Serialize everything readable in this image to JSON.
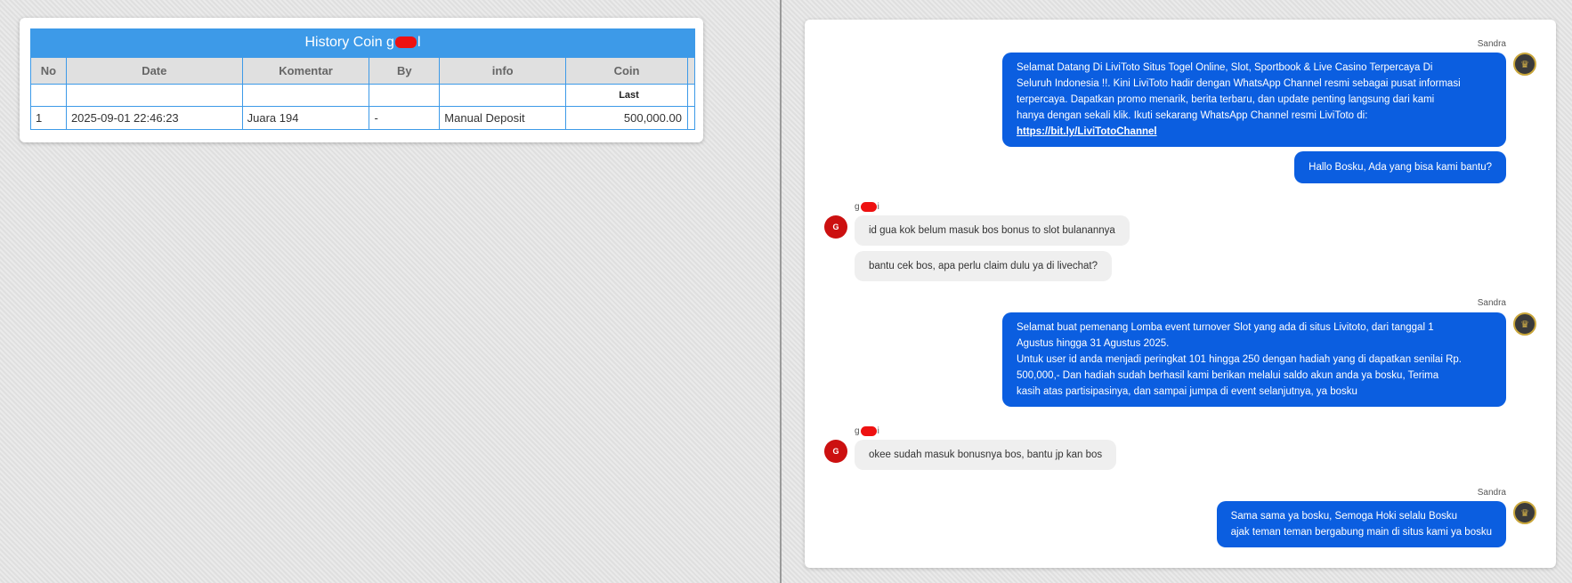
{
  "history": {
    "title_prefix": "History Coin g",
    "title_suffix": "l",
    "columns": [
      "No",
      "Date",
      "Komentar",
      "By",
      "info",
      "Coin"
    ],
    "sub_header": "Last",
    "rows": [
      {
        "no": "1",
        "date": "2025-09-01 22:46:23",
        "komentar": "Juara 194",
        "by": "-",
        "info": "Manual Deposit",
        "coin": "500,000.00"
      }
    ]
  },
  "chat": {
    "agent_name": "Sandra",
    "user_name_prefix": "g",
    "user_name_suffix": "i",
    "user_avatar_letter": "G",
    "messages": [
      {
        "from": "agent",
        "lines": [
          "Selamat Datang Di LiviToto Situs Togel Online, Slot, Sportbook & Live Casino Terpercaya Di",
          "Seluruh Indonesia !!. Kini LiviToto hadir dengan WhatsApp Channel resmi sebagai pusat informasi",
          "terpercaya. Dapatkan promo menarik, berita terbaru, dan update penting langsung dari kami",
          "hanya dengan sekali klik. Ikuti sekarang WhatsApp Channel resmi LiviToto di:"
        ],
        "link": "https://bit.ly/LiviTotoChannel"
      },
      {
        "from": "agent",
        "text": "Hallo Bosku, Ada yang bisa kami bantu?"
      },
      {
        "from": "user",
        "text": "id gua kok belum masuk bos bonus to slot bulanannya"
      },
      {
        "from": "user",
        "text": "bantu cek bos, apa perlu claim dulu ya di livechat?"
      },
      {
        "from": "agent",
        "lines": [
          "Selamat buat pemenang Lomba event turnover Slot yang ada di situs Livitoto, dari tanggal 1",
          "Agustus hingga 31 Agustus 2025.",
          "Untuk user id anda menjadi peringkat 101 hingga 250 dengan hadiah yang di dapatkan senilai Rp.",
          "500,000,- Dan hadiah sudah berhasil kami berikan melalui saldo akun anda ya bosku, Terima",
          "kasih atas partisipasinya, dan sampai jumpa di event selanjutnya, ya bosku"
        ]
      },
      {
        "from": "user",
        "text": "okee sudah masuk bonusnya bos, bantu jp kan bos"
      },
      {
        "from": "agent",
        "lines": [
          "Sama sama ya bosku, Semoga Hoki selalu Bosku",
          "ajak teman teman bergabung main di situs kami ya bosku"
        ]
      }
    ],
    "colors": {
      "agent_bubble": "#0b5ee0",
      "user_bubble": "#efefef",
      "header_blue": "#3d9ae8",
      "coin_green": "#2a8a1e"
    }
  }
}
